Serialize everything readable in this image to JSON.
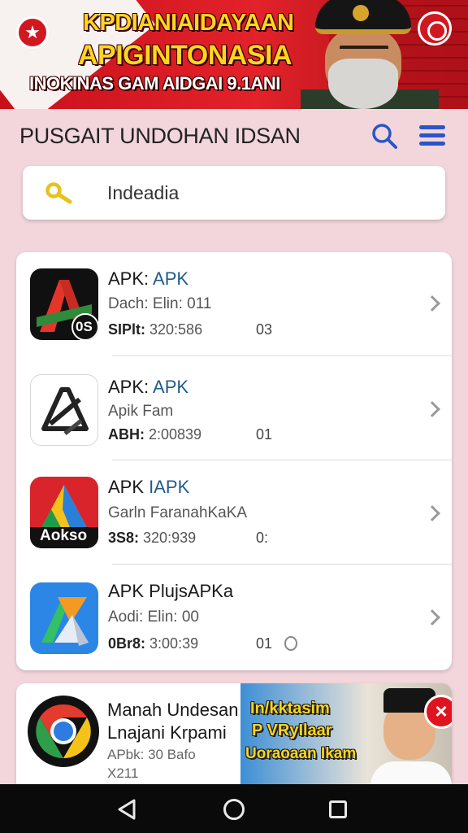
{
  "banner": {
    "line1": "KPDIANIAIDAYAAN",
    "line2": "APIGINTONASIA",
    "line3": "INOKINAS GAM AIDGAI 9.1ANI"
  },
  "header": {
    "title": "PUSGAIT UNDOHAN IDSAN"
  },
  "search": {
    "value": "Indeadia"
  },
  "apps": [
    {
      "name_prefix": "APK: ",
      "name_accent": "APK",
      "sub": "Dach: Elin: 011",
      "meta_label": "SIPlt:",
      "meta_value": " 320:586",
      "num": "03",
      "badge": "0S",
      "icon": "apk-red-icon"
    },
    {
      "name_prefix": "APK: ",
      "name_accent": "APK",
      "sub": "Apik Fam",
      "meta_label": "ABH:",
      "meta_value": " 2:00839",
      "num": "01",
      "icon": "apk-outline-icon"
    },
    {
      "name_prefix": "APK ",
      "name_accent": "IAPK",
      "sub": "Garln FaranahKaKA",
      "meta_label": "3S8:",
      "meta_value": " 320:939",
      "num": "0:",
      "icon_label": "Aokso",
      "icon": "apk-aokso-icon"
    },
    {
      "name_prefix": "APK ",
      "name_accent": "PlujsAPKa",
      "sub": "Aodi: Elin: 00",
      "meta_label": "0Br8:",
      "meta_value": " 3:00:39",
      "num": "01",
      "icon": "apk-blue-icon"
    }
  ],
  "ad": {
    "title1": "Manah Undesan",
    "title2": "Lnajani Krpami",
    "sub1": "APbk: 30 Bafo",
    "sub2": "X211",
    "promo1": "In/kktasim",
    "promo2": "P VRyIlaar",
    "promo3": "Uoraoaan Ikam",
    "close": "×"
  },
  "colors": {
    "background": "#f2d6dc",
    "banner_red": "#d11820",
    "banner_text": "#ffd61f",
    "accent_blue": "#2a55c9",
    "link_blue": "#235a8c"
  }
}
